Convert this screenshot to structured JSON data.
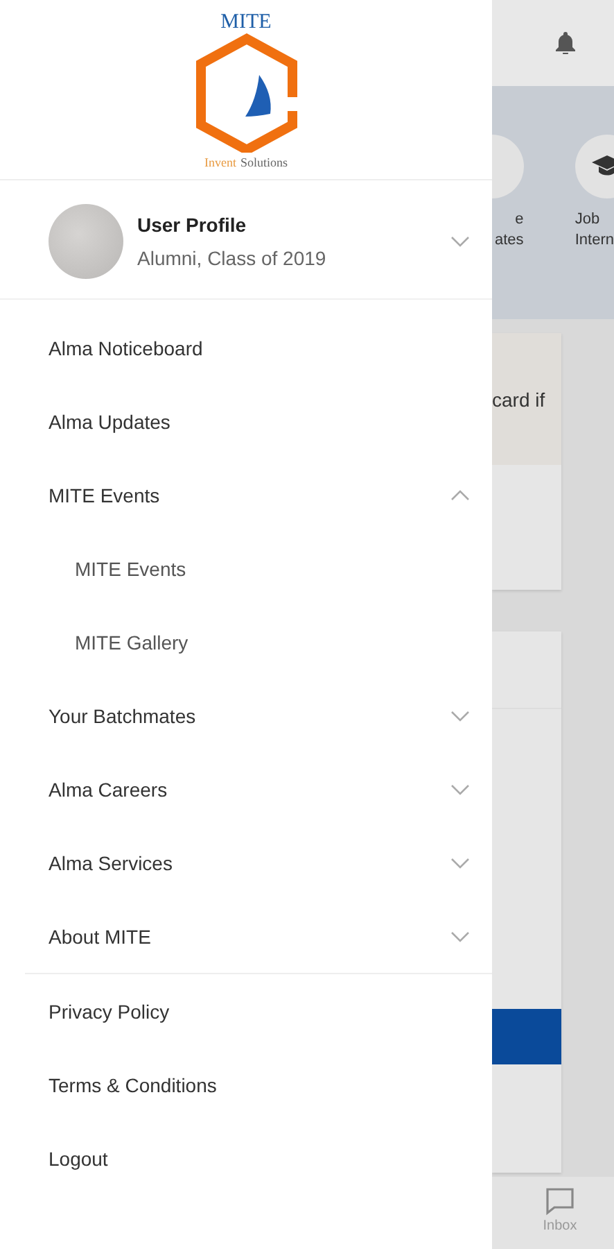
{
  "drawer": {
    "logo": {
      "title": "MITE",
      "tagline_first": "Invent",
      "tagline_rest": "Solutions"
    },
    "profile": {
      "name": "User Profile",
      "subtitle": "Alumni, Class of 2019",
      "expanded": false
    },
    "menu": [
      {
        "kind": "link",
        "label": "Alma Noticeboard"
      },
      {
        "kind": "link",
        "label": "Alma Updates"
      },
      {
        "kind": "expandable",
        "label": "MITE Events",
        "expanded": true,
        "children": [
          {
            "label": "MITE Events"
          },
          {
            "label": "MITE Gallery"
          }
        ]
      },
      {
        "kind": "expandable",
        "label": "Your Batchmates",
        "expanded": false
      },
      {
        "kind": "expandable",
        "label": "Alma Careers",
        "expanded": false
      },
      {
        "kind": "expandable",
        "label": "Alma Services",
        "expanded": false
      },
      {
        "kind": "expandable",
        "label": "About MITE",
        "expanded": false
      }
    ],
    "footer": [
      {
        "label": "Privacy Policy"
      },
      {
        "label": "Terms & Conditions"
      },
      {
        "label": "Logout"
      }
    ]
  },
  "background": {
    "shortcuts": [
      {
        "line_1": "e",
        "line_2": "ates"
      },
      {
        "line_1": "Job",
        "line_2": "Intern"
      }
    ],
    "card_text": "card if",
    "nav": [
      {
        "label": "Inbox"
      }
    ]
  }
}
